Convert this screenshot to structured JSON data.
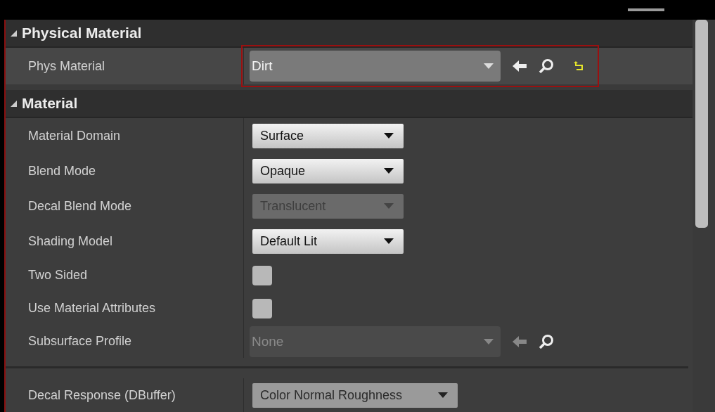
{
  "sections": [
    {
      "title": "Physical Material",
      "expanded": true,
      "properties": [
        {
          "kind": "asset",
          "label": "Phys Material",
          "value": "Dirt",
          "disabled": false,
          "reset": true,
          "highlighted": true
        }
      ]
    },
    {
      "title": "Material",
      "expanded": true,
      "properties": [
        {
          "kind": "dropdown",
          "label": "Material Domain",
          "value": "Surface",
          "disabled": false
        },
        {
          "kind": "dropdown",
          "label": "Blend Mode",
          "value": "Opaque",
          "disabled": false
        },
        {
          "kind": "dropdown",
          "label": "Decal Blend Mode",
          "value": "Translucent",
          "disabled": true
        },
        {
          "kind": "dropdown",
          "label": "Shading Model",
          "value": "Default Lit",
          "disabled": false
        },
        {
          "kind": "checkbox",
          "label": "Two Sided",
          "checked": false
        },
        {
          "kind": "checkbox",
          "label": "Use Material Attributes",
          "checked": false
        },
        {
          "kind": "asset",
          "label": "Subsurface Profile",
          "value": "None",
          "disabled": true
        },
        {
          "kind": "separator"
        },
        {
          "kind": "flatdropdown",
          "label": "Decal Response (DBuffer)",
          "value": "Color Normal Roughness"
        }
      ]
    }
  ]
}
